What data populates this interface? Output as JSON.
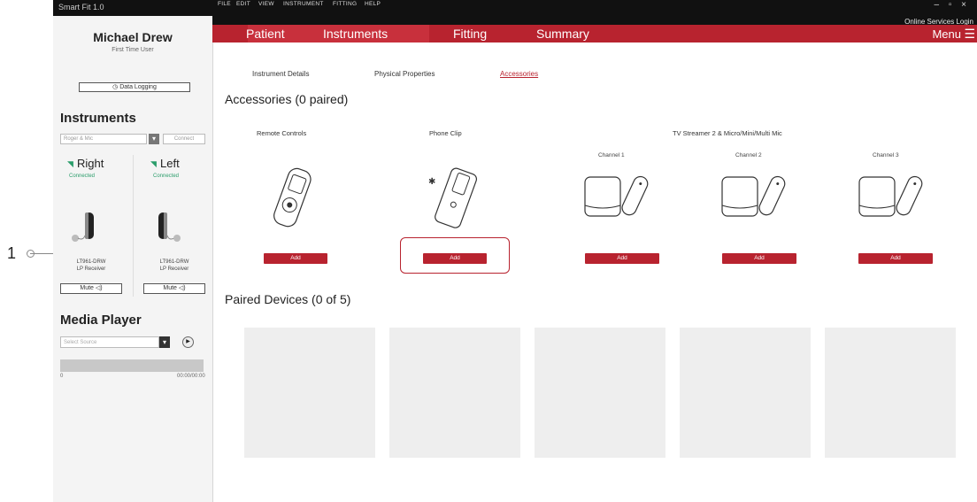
{
  "callout": {
    "number": "1"
  },
  "window": {
    "title": "Smart Fit 1.0",
    "controls": "– ▫ ×",
    "online_login": "Online Services Login"
  },
  "sidebar": {
    "patient_name": "Michael Drew",
    "patient_status": "First Time User",
    "data_logging": "Data Logging",
    "instruments_heading": "Instruments",
    "mode_select": "Roger & Mic",
    "connect_label": "Connect",
    "right": {
      "label": "Right",
      "status": "Connected",
      "model": "LT961-DRW",
      "receiver": "LP Receiver",
      "mute": "Mute"
    },
    "left": {
      "label": "Left",
      "status": "Connected",
      "model": "LT961-DRW",
      "receiver": "LP Receiver",
      "mute": "Mute"
    },
    "media_heading": "Media Player",
    "source_placeholder": "Select Source",
    "time_start": "0",
    "time_total": "00:00/00:00",
    "progress": 1.0
  },
  "menubar": {
    "items": [
      "FILE",
      "EDIT",
      "VIEW",
      "INSTRUMENT",
      "FITTING",
      "HELP"
    ]
  },
  "nav": {
    "tabs": [
      "Patient",
      "Instruments",
      "Fitting",
      "Summary"
    ],
    "active": "Instruments",
    "menu_label": "Menu",
    "menu_icon": "hamburger-icon"
  },
  "subtabs": {
    "items": [
      "Instrument Details",
      "Physical Properties",
      "Accessories"
    ],
    "active": "Accessories"
  },
  "accessories": {
    "heading": "Accessories (0 paired)",
    "remote_controls": "Remote Controls",
    "phone_clip": "Phone Clip",
    "tv_streamer": "TV Streamer 2 & Micro/Mini/Multi Mic",
    "channels": [
      "Channel 1",
      "Channel 2",
      "Channel 3"
    ],
    "add_label": "Add"
  },
  "paired": {
    "heading": "Paired Devices (0 of 5)",
    "slot_count": 5
  },
  "colors": {
    "brand_red": "#b8232f",
    "connected_green": "#2a9d6a"
  }
}
